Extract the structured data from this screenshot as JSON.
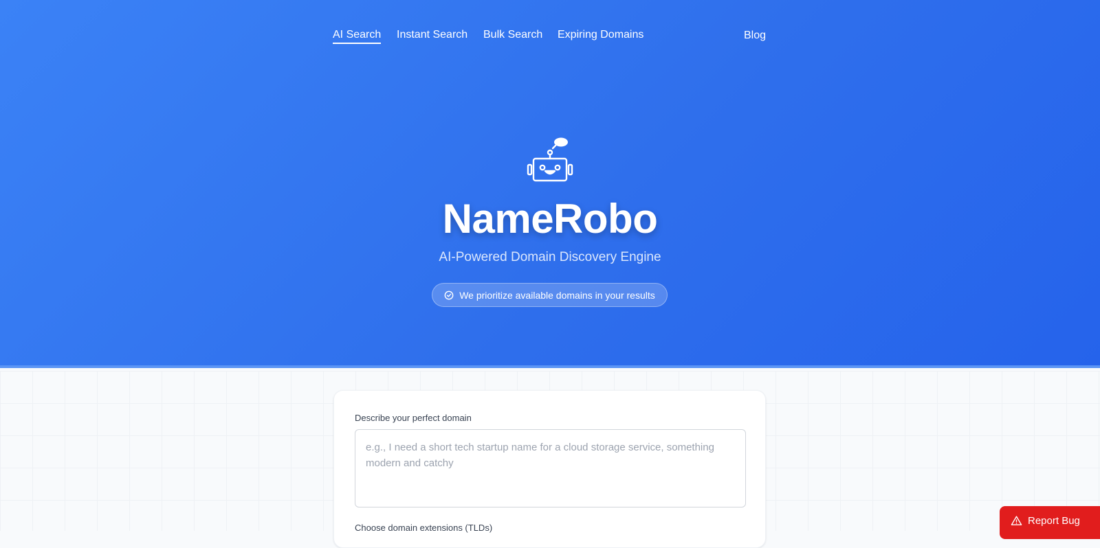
{
  "nav": {
    "items": [
      {
        "label": "AI Search",
        "active": true
      },
      {
        "label": "Instant Search",
        "active": false
      },
      {
        "label": "Bulk Search",
        "active": false
      },
      {
        "label": "Expiring Domains",
        "active": false
      }
    ],
    "blog_label": "Blog"
  },
  "hero": {
    "logo_icon": "robot-icon",
    "title": "NameRobo",
    "subtitle": "AI-Powered Domain Discovery Engine",
    "badge_icon": "check-circle-icon",
    "badge_text": "We prioritize available domains in your results"
  },
  "form": {
    "describe_label": "Describe your perfect domain",
    "describe_placeholder": "e.g., I need a short tech startup name for a cloud storage service, something modern and catchy",
    "describe_value": "",
    "tld_label": "Choose domain extensions (TLDs)"
  },
  "report_bug": {
    "icon": "warning-triangle-icon",
    "label": "Report Bug"
  },
  "colors": {
    "hero_gradient_start": "#3b82f6",
    "hero_gradient_end": "#2563eb",
    "report_bug_bg": "#e11d1d"
  }
}
